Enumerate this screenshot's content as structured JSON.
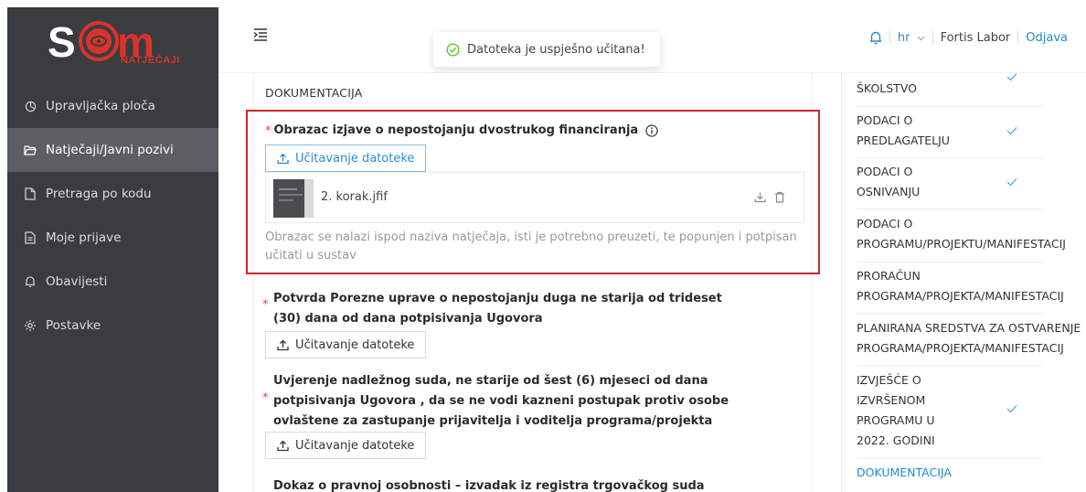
{
  "brand": {
    "logo_text": "SOM",
    "logo_subtext": "NATJEČAJI",
    "colors": {
      "sidebar": "#3a3d40",
      "active": "#5b5f63",
      "accent": "#1f8bd1",
      "required": "#e8434b",
      "highlight": "#d0232b",
      "logo_red": "#d9332b"
    }
  },
  "sidebar": {
    "items": [
      {
        "label": "Upravljačka ploča",
        "icon": "dashboard-icon"
      },
      {
        "label": "Natječaji/Javni pozivi",
        "icon": "folder-open-icon"
      },
      {
        "label": "Pretraga po kodu",
        "icon": "file-icon"
      },
      {
        "label": "Moje prijave",
        "icon": "file-text-icon"
      },
      {
        "label": "Obavijesti",
        "icon": "bell-icon"
      },
      {
        "label": "Postavke",
        "icon": "gear-icon"
      }
    ]
  },
  "header": {
    "toast": "Datoteka je uspješno učitana!",
    "language": "hr",
    "user": "Fortis Labor",
    "logout": "Odjava"
  },
  "main": {
    "section_title": "DOKUMENTACIJA",
    "fields": [
      {
        "label": "Obrazac izjave o nepostojanju dvostrukog financiranja",
        "button": "Učitavanje datoteke",
        "file_name": "2. korak.jfif",
        "hint": "Obrazac se nalazi ispod naziva natječaja, isti je potrebno preuzeti, te popunjen i potpisan učitati u sustav"
      },
      {
        "label_line1": "Potvrda Porezne uprave o nepostojanju duga ne starija od trideset",
        "label_line2": "(30) dana od dana potpisivanja Ugovora",
        "button": "Učitavanje datoteke"
      },
      {
        "label_line1": "Uvjerenje nadležnog suda, ne starije od šest (6) mjeseci od dana",
        "label_line2": "potpisivanja Ugovora , da se ne vodi kazneni postupak protiv osobe",
        "label_line3": "ovlaštene za zastupanje prijavitelja i voditelja programa/projekta",
        "button": "Učitavanje datoteke"
      },
      {
        "label_line1": "Dokaz o pravnoj osobnosti – izvadak iz registra trgovačkog suda"
      }
    ]
  },
  "steps": [
    {
      "line1": "ŠKOLSTVO",
      "done": true
    },
    {
      "line1": "PODACI O",
      "line2": "PREDLAGATELJU",
      "done": true
    },
    {
      "line1": "PODACI O",
      "line2": "OSNIVANJU",
      "done": true
    },
    {
      "line1": "PODACI O",
      "line2": "PROGRAMU/PROJEKTU/MANIFESTACIJ",
      "done": false
    },
    {
      "line1": "PRORAČUN",
      "line2": "PROGRAMA/PROJEKTA/MANIFESTACIJ",
      "done": false
    },
    {
      "line1": "PLANIRANA SREDSTVA ZA OSTVARENJE",
      "line2": "PROGRAMA/PROJEKTA/MANIFESTACIJ",
      "done": false
    },
    {
      "line1": "IZVJEŠĆE O",
      "line2": "IZVRŠENOM",
      "line3": "PROGRAMU U",
      "line4": "2022. GODINI",
      "done": true
    },
    {
      "line1": "DOKUMENTACIJA",
      "done": false
    }
  ]
}
